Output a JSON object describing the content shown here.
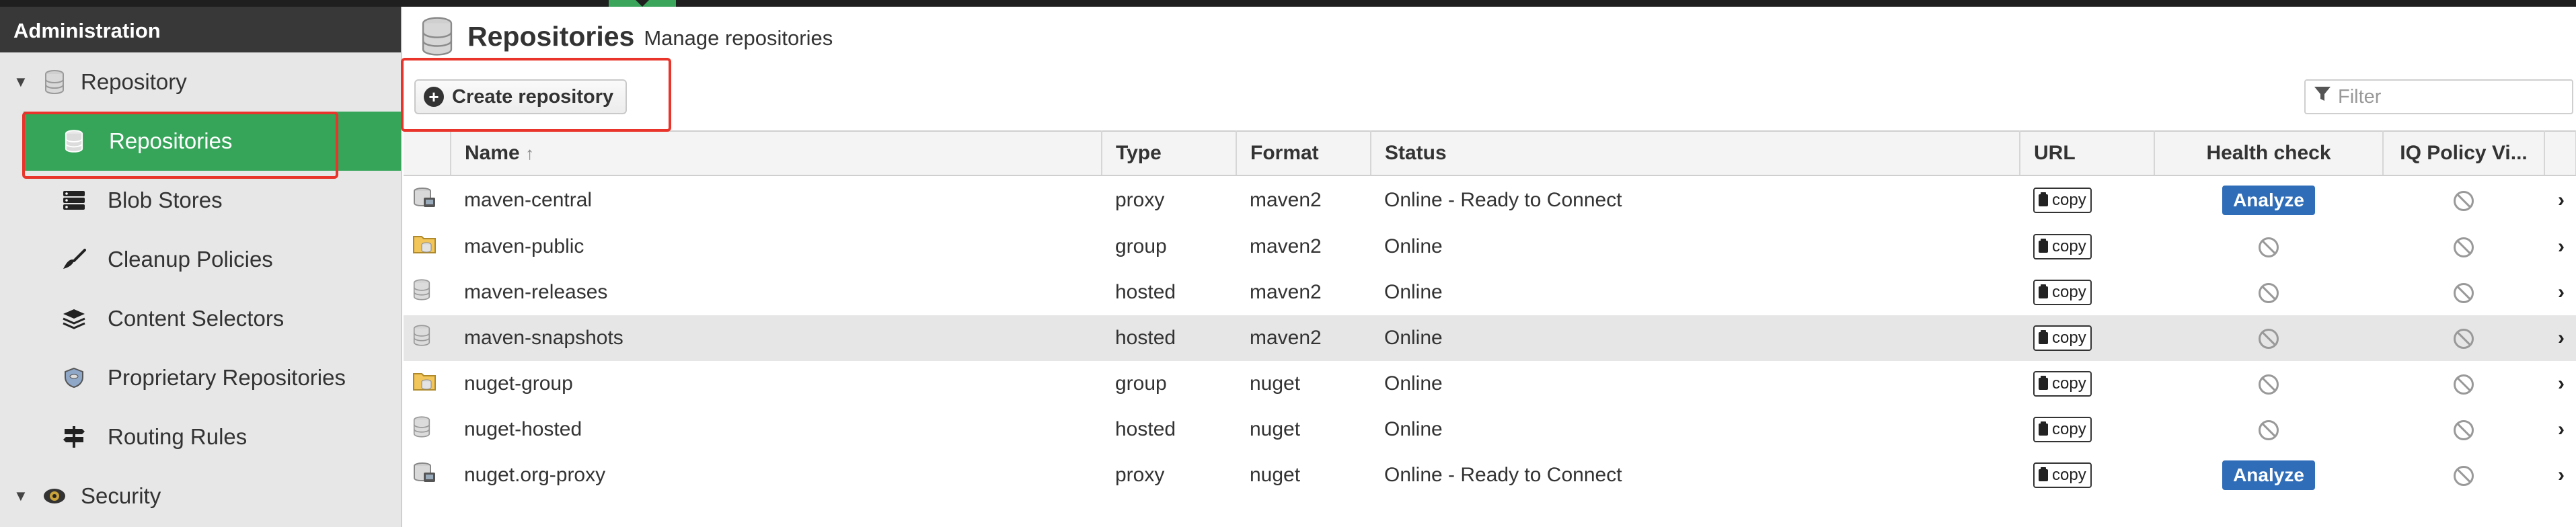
{
  "sidebar": {
    "header": "Administration",
    "group": "Repository",
    "items": [
      {
        "label": "Repositories",
        "icon": "database-icon"
      },
      {
        "label": "Blob Stores",
        "icon": "server-icon"
      },
      {
        "label": "Cleanup Policies",
        "icon": "broom-icon"
      },
      {
        "label": "Content Selectors",
        "icon": "layers-icon"
      },
      {
        "label": "Proprietary Repositories",
        "icon": "shield-icon"
      },
      {
        "label": "Routing Rules",
        "icon": "signpost-icon"
      }
    ],
    "group2": "Security"
  },
  "page": {
    "title": "Repositories",
    "subtitle": "Manage repositories"
  },
  "toolbar": {
    "create_label": "Create repository",
    "filter_placeholder": "Filter"
  },
  "table": {
    "columns": [
      "Name",
      "Type",
      "Format",
      "Status",
      "URL",
      "Health check",
      "IQ Policy Vi..."
    ],
    "sort_indicator": "↑",
    "copy_label": "copy",
    "analyze_label": "Analyze",
    "rows": [
      {
        "name": "maven-central",
        "type": "proxy",
        "format": "maven2",
        "status": "Online - Ready to Connect",
        "health": "analyze",
        "icon": "proxy-repo-icon"
      },
      {
        "name": "maven-public",
        "type": "group",
        "format": "maven2",
        "status": "Online",
        "health": "na",
        "icon": "group-repo-icon"
      },
      {
        "name": "maven-releases",
        "type": "hosted",
        "format": "maven2",
        "status": "Online",
        "health": "na",
        "icon": "hosted-repo-icon"
      },
      {
        "name": "maven-snapshots",
        "type": "hosted",
        "format": "maven2",
        "status": "Online",
        "health": "na",
        "icon": "hosted-repo-icon"
      },
      {
        "name": "nuget-group",
        "type": "group",
        "format": "nuget",
        "status": "Online",
        "health": "na",
        "icon": "group-repo-icon"
      },
      {
        "name": "nuget-hosted",
        "type": "hosted",
        "format": "nuget",
        "status": "Online",
        "health": "na",
        "icon": "hosted-repo-icon"
      },
      {
        "name": "nuget.org-proxy",
        "type": "proxy",
        "format": "nuget",
        "status": "Online - Ready to Connect",
        "health": "analyze",
        "icon": "proxy-repo-icon"
      }
    ]
  },
  "colors": {
    "active_nav": "#36a55a",
    "highlight": "#e8342a",
    "analyze": "#2f6db8",
    "sidebar_header": "#383838"
  }
}
